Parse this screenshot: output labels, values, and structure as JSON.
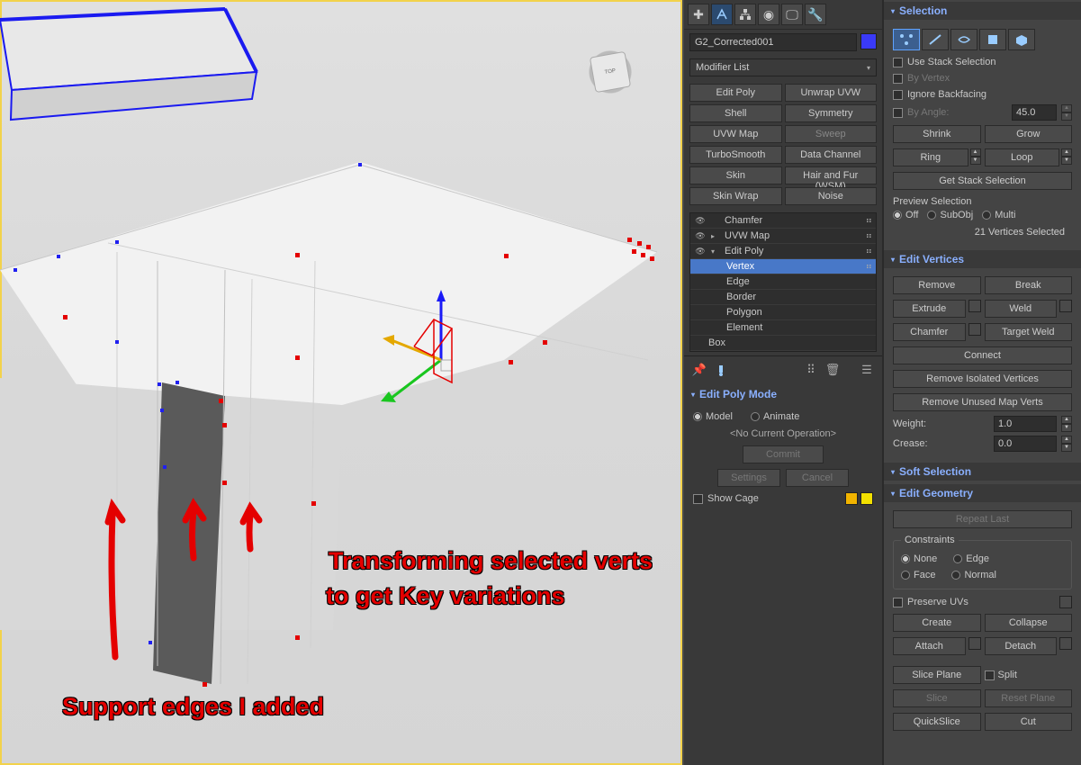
{
  "viewport": {
    "viewcube_label": "TOP",
    "annotation1": "Transforming selected verts",
    "annotation2": "to get Key variations",
    "annotation3": "Support edges I added"
  },
  "modify": {
    "object_name": "G2_Corrected001",
    "dropdown": "Modifier List",
    "mods": {
      "edit_poly": "Edit Poly",
      "unwrap_uvw": "Unwrap UVW",
      "shell": "Shell",
      "symmetry": "Symmetry",
      "uvw_map": "UVW Map",
      "sweep": "Sweep",
      "turbosmooth": "TurboSmooth",
      "data_channel": "Data Channel",
      "skin": "Skin",
      "hair_fur": "Hair and Fur (WSM)",
      "skin_wrap": "Skin Wrap",
      "noise": "Noise"
    },
    "stack": {
      "chamfer": "Chamfer",
      "uvw_map": "UVW Map",
      "edit_poly": "Edit Poly",
      "vertex": "Vertex",
      "edge": "Edge",
      "border": "Border",
      "polygon": "Polygon",
      "element": "Element",
      "box": "Box"
    }
  },
  "edit_poly_mode": {
    "title": "Edit Poly Mode",
    "model": "Model",
    "animate": "Animate",
    "no_op": "<No Current Operation>",
    "commit": "Commit",
    "settings": "Settings",
    "cancel": "Cancel",
    "show_cage": "Show Cage"
  },
  "selection": {
    "title": "Selection",
    "use_stack": "Use Stack Selection",
    "by_vertex": "By Vertex",
    "ignore_backfacing": "Ignore Backfacing",
    "by_angle": "By Angle:",
    "angle_value": "45.0",
    "shrink": "Shrink",
    "grow": "Grow",
    "ring": "Ring",
    "loop": "Loop",
    "get_stack": "Get Stack Selection",
    "preview": "Preview Selection",
    "off": "Off",
    "subobj": "SubObj",
    "multi": "Multi",
    "status": "21 Vertices Selected"
  },
  "edit_vertices": {
    "title": "Edit Vertices",
    "remove": "Remove",
    "break": "Break",
    "extrude": "Extrude",
    "weld": "Weld",
    "chamfer": "Chamfer",
    "target_weld": "Target Weld",
    "connect": "Connect",
    "remove_iso": "Remove Isolated Vertices",
    "remove_map": "Remove Unused Map Verts",
    "weight": "Weight:",
    "weight_val": "1.0",
    "crease": "Crease:",
    "crease_val": "0.0"
  },
  "soft_selection": {
    "title": "Soft Selection"
  },
  "edit_geometry": {
    "title": "Edit Geometry",
    "repeat_last": "Repeat Last",
    "constraints": "Constraints",
    "none": "None",
    "edge": "Edge",
    "face": "Face",
    "normal": "Normal",
    "preserve_uvs": "Preserve UVs",
    "create": "Create",
    "collapse": "Collapse",
    "attach": "Attach",
    "detach": "Detach",
    "slice_plane": "Slice Plane",
    "split": "Split",
    "slice": "Slice",
    "reset_plane": "Reset Plane",
    "quickslice": "QuickSlice",
    "cut": "Cut"
  }
}
